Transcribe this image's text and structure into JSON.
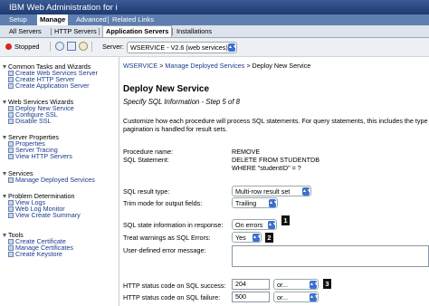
{
  "app_title": "IBM Web Administration for i",
  "top_nav": {
    "setup": "Setup",
    "manage": "Manage",
    "advanced": "Advanced",
    "related_links": "Related Links"
  },
  "tabs": {
    "all_servers": "All Servers",
    "http_servers": "HTTP Servers",
    "application_servers": "Application Servers",
    "installations": "Installations"
  },
  "server_bar": {
    "status": "Stopped",
    "server_label": "Server:",
    "server_value": "WSERVICE - V2.6 (web services)"
  },
  "left_nav": {
    "common_tasks": {
      "title": "Common Tasks and Wizards",
      "items": [
        "Create Web Services Server",
        "Create HTTP Server",
        "Create Application Server"
      ]
    },
    "ws_wizards": {
      "title": "Web Services Wizards",
      "items": [
        "Deploy New Service",
        "Configure SSL",
        "Disable SSL"
      ]
    },
    "server_properties": {
      "title": "Server Properties",
      "items": [
        "Properties",
        "Server Tracing",
        "View HTTP Servers"
      ]
    },
    "services": {
      "title": "Services",
      "items": [
        "Manage Deployed Services"
      ]
    },
    "problem_determination": {
      "title": "Problem Determination",
      "items": [
        "View Logs",
        "Web Log Monitor",
        "View Create Summary"
      ]
    },
    "tools": {
      "title": "Tools",
      "items": [
        "Create Certificate",
        "Manage Certificates",
        "Create Keystore"
      ]
    }
  },
  "breadcrumb": {
    "server": "WSERVICE",
    "sep": ">",
    "manage": "Manage Deployed Services",
    "current": "Deploy New Service"
  },
  "page": {
    "title": "Deploy New Service",
    "subtitle": "Specify SQL Information - Step 5 of 8",
    "description_1": "Customize how each procedure will process SQL statements. For query statements, this includes the type",
    "description_2": "pagination is handled for result sets."
  },
  "form": {
    "procedure_name_label": "Procedure name:",
    "procedure_name_value": "REMOVE",
    "sql_statement_label": "SQL Statement:",
    "sql_statement_line1": "DELETE FROM STUDENTDB",
    "sql_statement_line2": "WHERE \"studentID\" = ?",
    "sql_result_type_label": "SQL result type:",
    "sql_result_type_value": "Multi-row result set",
    "trim_mode_label": "Trim mode for output fields:",
    "trim_mode_value": "Trailing",
    "sql_state_label": "SQL state information in response:",
    "sql_state_value": "On errors",
    "treat_warnings_label": "Treat warnings as SQL Errors:",
    "treat_warnings_value": "Yes",
    "user_error_label": "User-defined error message:",
    "user_error_value": "",
    "http_success_label": "HTTP status code on SQL success:",
    "http_success_value": "204",
    "http_success_select": "or...",
    "http_failure_label": "HTTP status code on SQL failure:",
    "http_failure_value": "500",
    "http_failure_select": "or..."
  },
  "badges": {
    "b1": "1",
    "b2": "2",
    "b3": "3"
  },
  "colors": {
    "header_blue": "#2c4a85",
    "nav_blue": "#5e7faf",
    "link_blue": "#1a3b8c",
    "stopped_red": "#d7261e",
    "select_blue": "#3b6fd1"
  }
}
